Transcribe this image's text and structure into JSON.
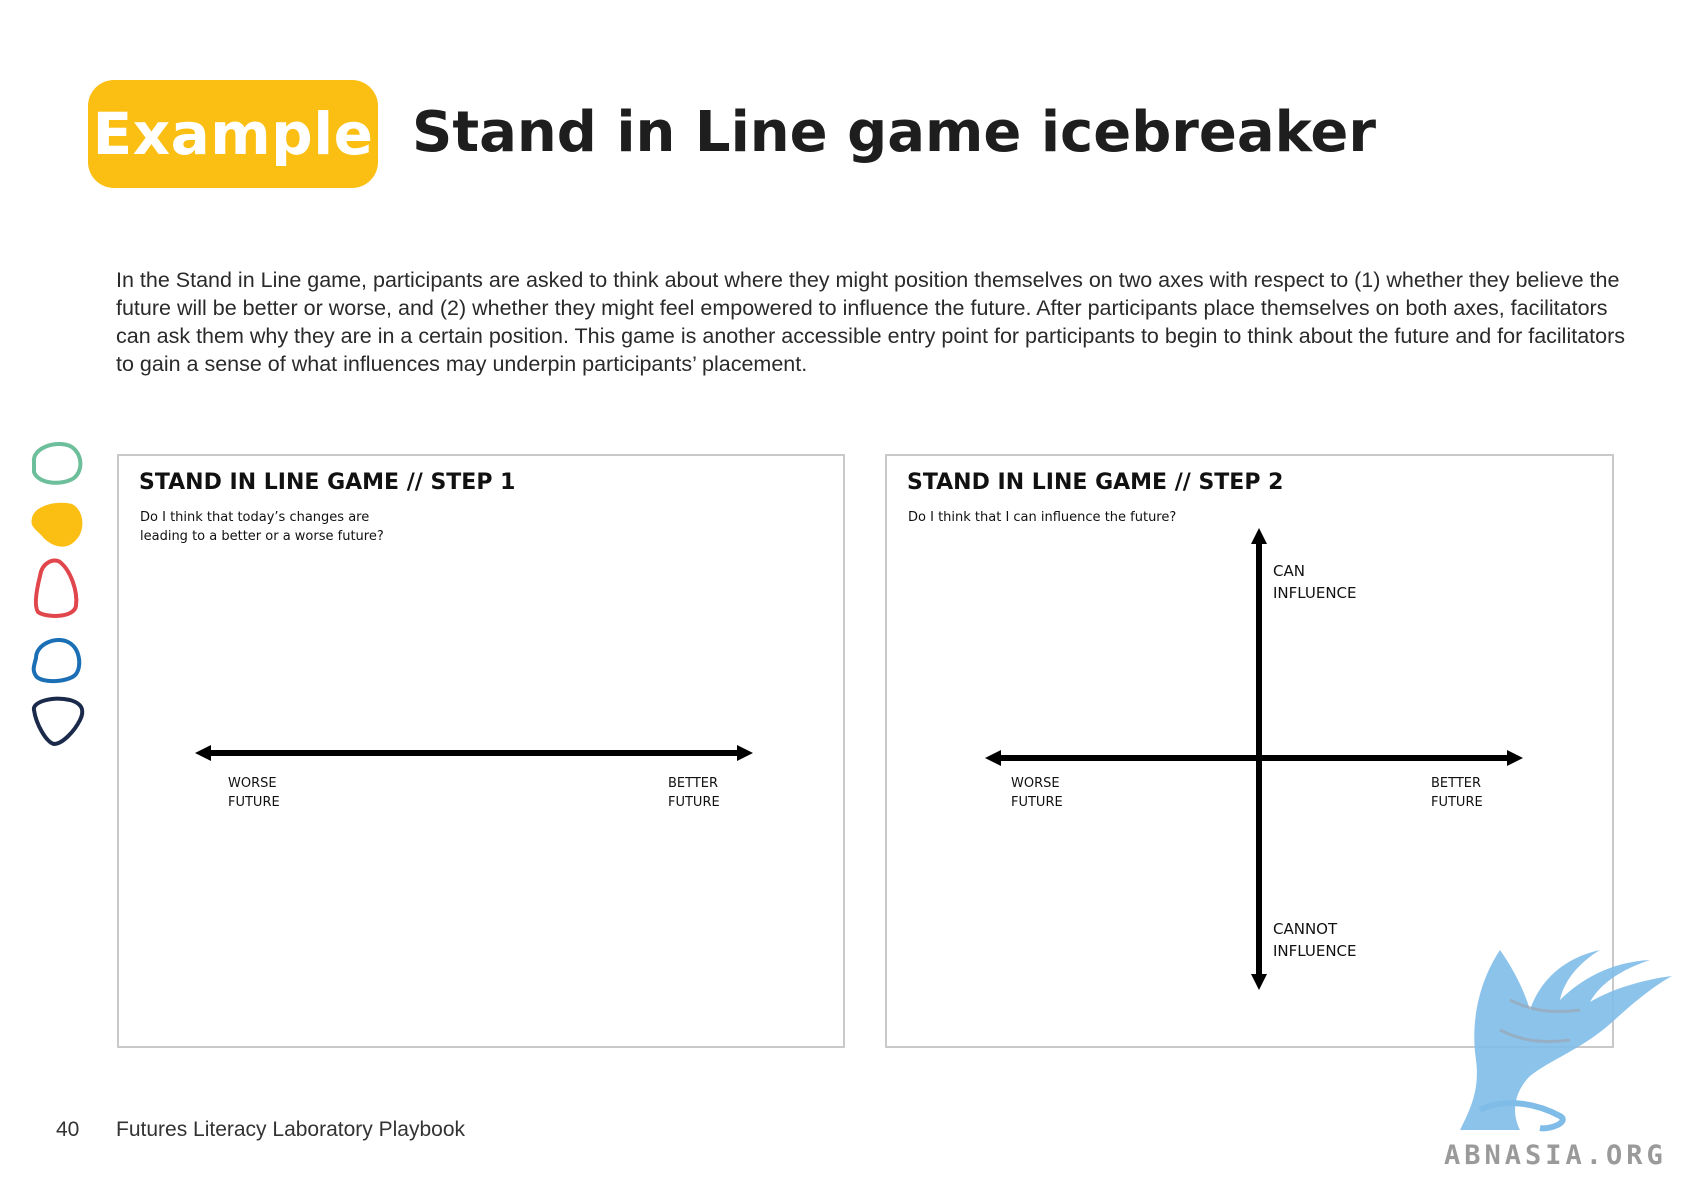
{
  "header": {
    "badge": "Example",
    "title": "Stand in Line game icebreaker",
    "badge_color": "#fbbf14"
  },
  "intro": "In the Stand in Line game, participants are asked to think about where they might position themselves on two axes with respect to (1) whether they believe the future will be better or worse, and (2) whether they might feel empowered to influence the future.  After participants place themselves on both axes, facilitators can ask them why they are in a certain position. This game is another accessible entry point for participants to begin to think about the future and for facilitators to gain a sense of what influences may underpin participants’ placement.",
  "side_shapes": {
    "colors": [
      "#6cbf9a",
      "#fbbf14",
      "#e0464b",
      "#1a6fb5",
      "#1b2a4a"
    ]
  },
  "step1": {
    "title": "STAND IN LINE GAME // STEP 1",
    "question_line1": "Do I think that today’s changes are",
    "question_line2": "leading to a better or a worse future?",
    "left_line1": "WORSE",
    "left_line2": "FUTURE",
    "right_line1": "BETTER",
    "right_line2": "FUTURE"
  },
  "step2": {
    "title": "STAND IN LINE GAME // STEP 2",
    "question": "Do I think that I can influence the future?",
    "top_line1": "CAN",
    "top_line2": "INFLUENCE",
    "bottom_line1": "CANNOT",
    "bottom_line2": "INFLUENCE",
    "left_line1": "WORSE",
    "left_line2": "FUTURE",
    "right_line1": "BETTER",
    "right_line2": "FUTURE"
  },
  "footer": {
    "page_number": "40",
    "book_title": "Futures Literacy Laboratory Playbook"
  },
  "watermark": {
    "text": "ABNASIA.ORG",
    "icon": "griffin-logo-icon",
    "color": "#7fbde8"
  }
}
